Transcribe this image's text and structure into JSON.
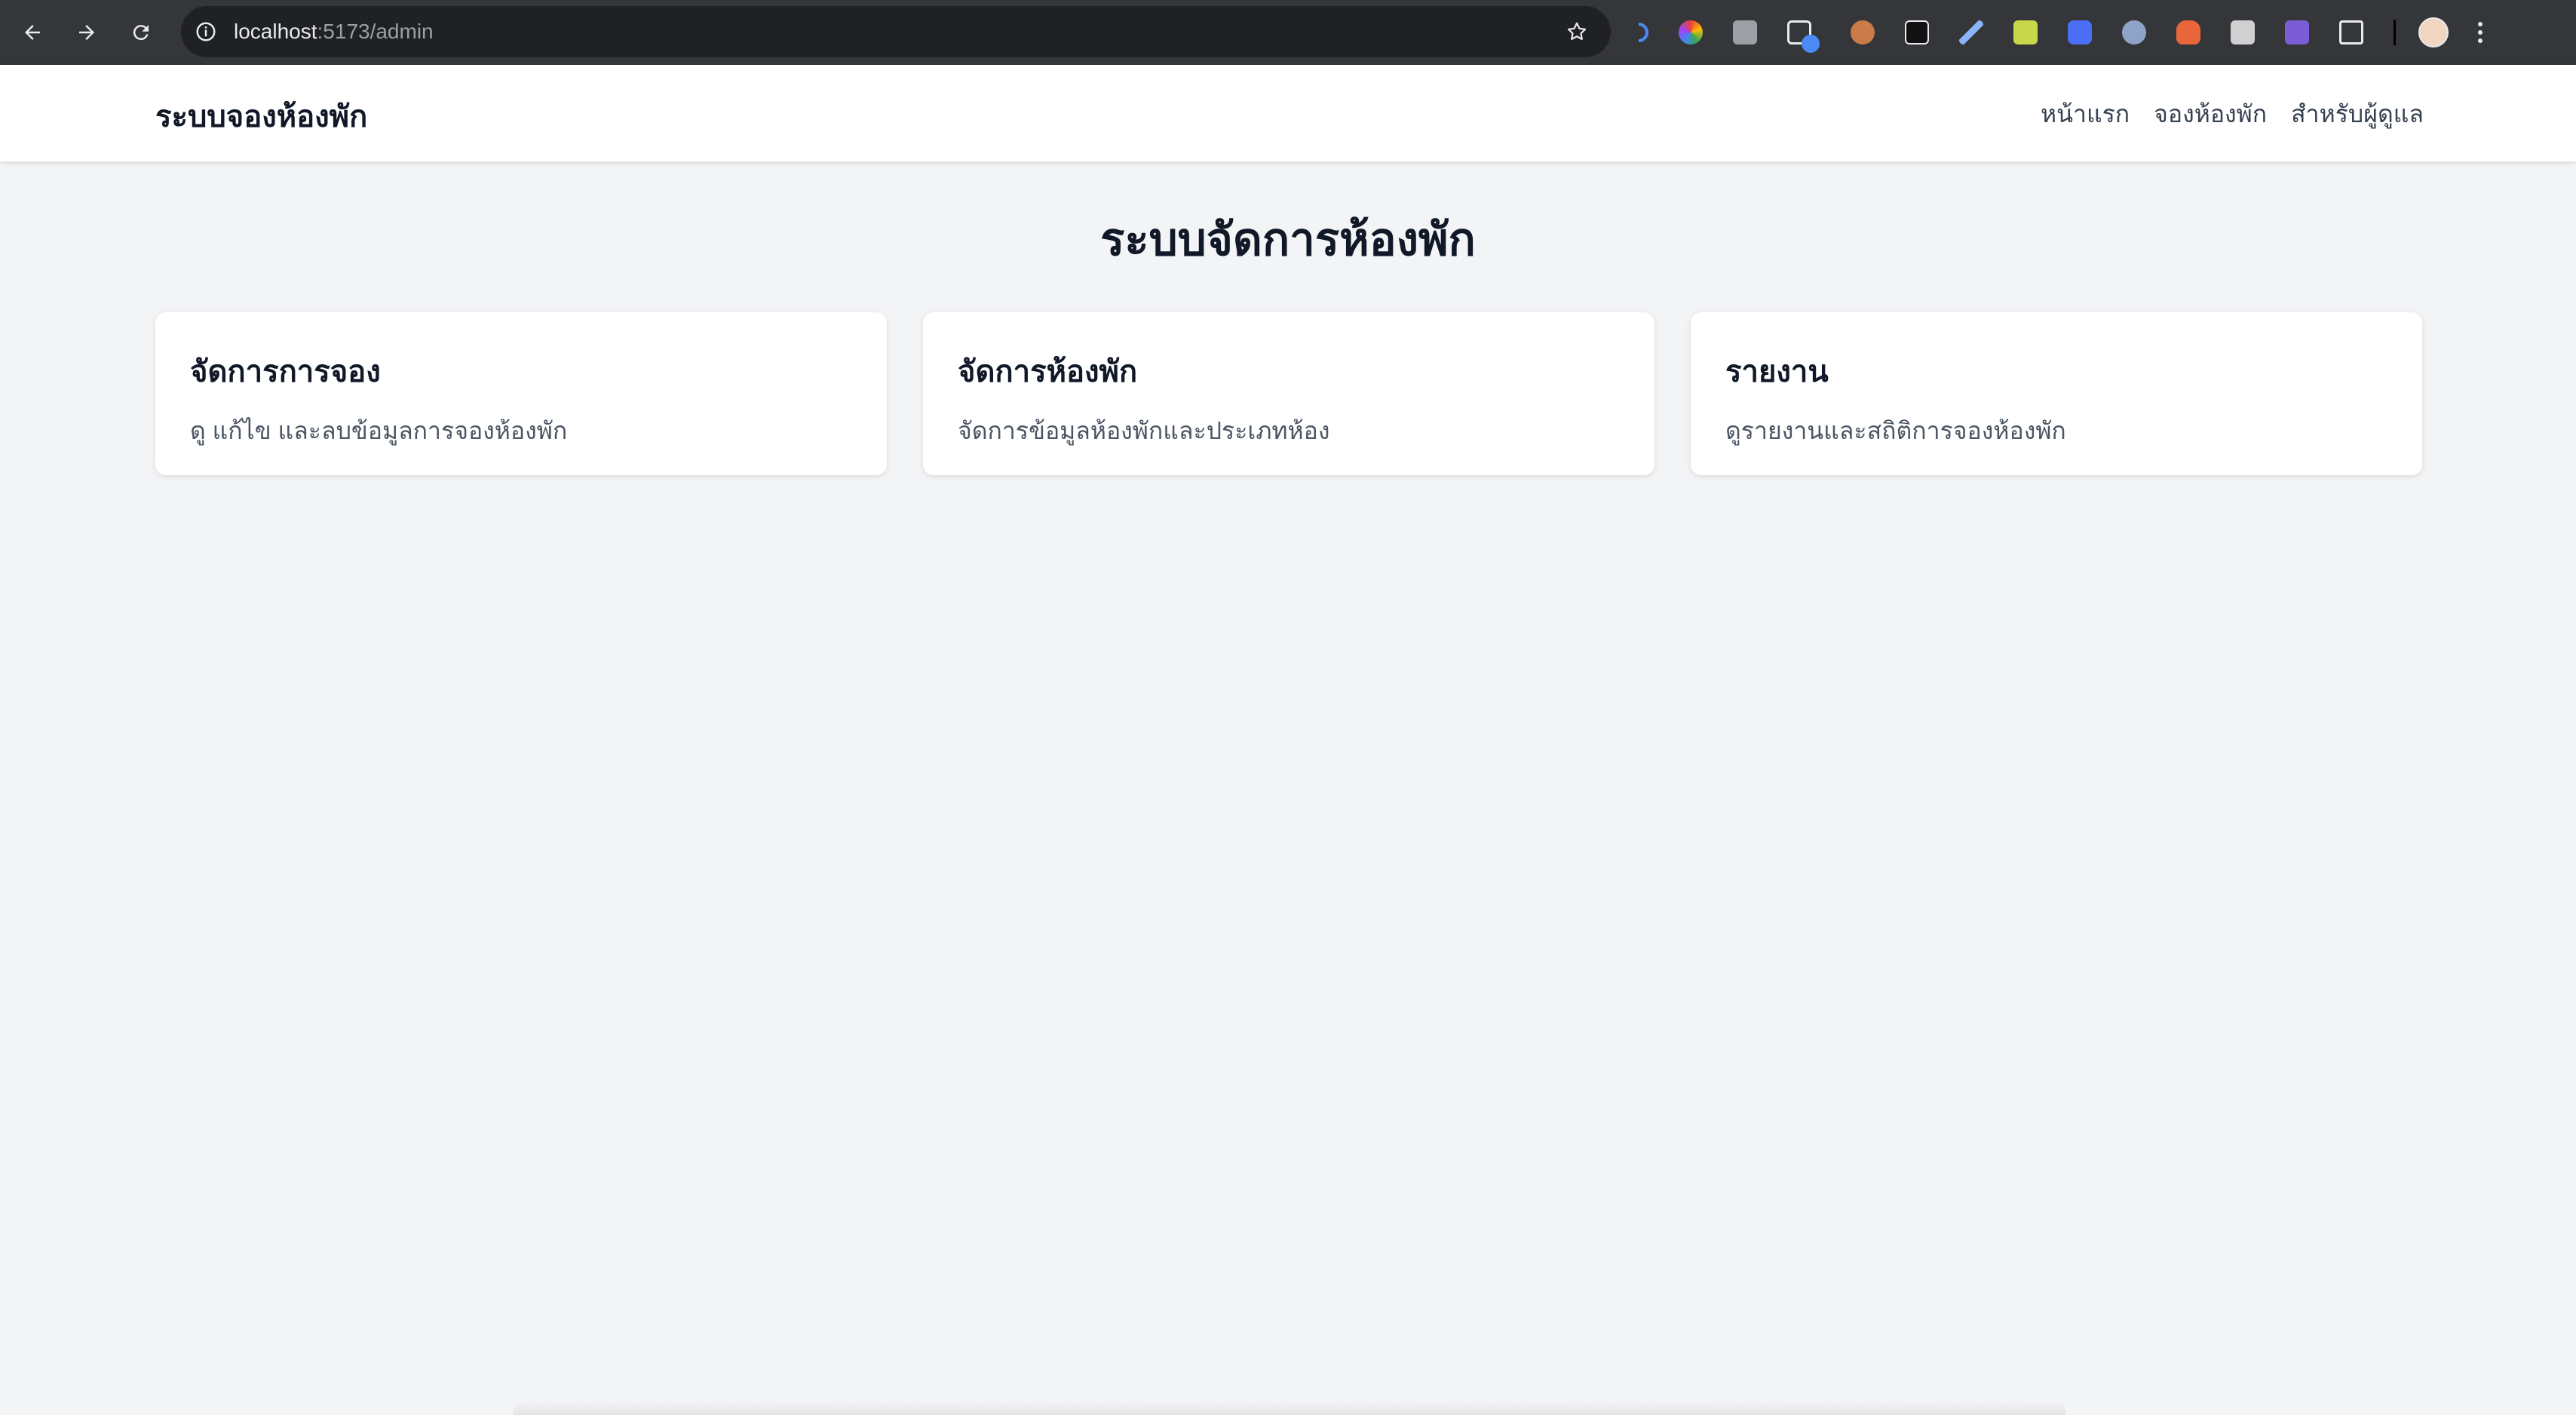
{
  "browser": {
    "url_host": "localhost",
    "url_path": ":5173/admin",
    "extensions": [
      {
        "name": "voice-icon",
        "color": "#4c8bf5"
      },
      {
        "name": "color-wheel-icon",
        "color": "#e84393"
      },
      {
        "name": "camera-icon",
        "color": "#9aa0a6"
      },
      {
        "name": "screen-share-icon",
        "color": "#8ab4f8"
      },
      {
        "name": "cookie-icon",
        "color": "#c97b4a"
      },
      {
        "name": "glasses-icon",
        "color": "#ffffff"
      },
      {
        "name": "pen-icon",
        "color": "#8ab4f8"
      },
      {
        "name": "notes-icon",
        "color": "#c8d64a"
      },
      {
        "name": "doc-icon",
        "color": "#4c6ef5"
      },
      {
        "name": "gear-ext-icon",
        "color": "#8fa3c8"
      },
      {
        "name": "fox-icon",
        "color": "#e8663a"
      },
      {
        "name": "swift-icon",
        "color": "#d0d0d0"
      },
      {
        "name": "v-icon",
        "color": "#7b5cd6"
      },
      {
        "name": "puzzle-icon",
        "color": "#e8eaed"
      }
    ]
  },
  "header": {
    "brand": "ระบบจองห้องพัก",
    "nav": [
      {
        "label": "หน้าแรก"
      },
      {
        "label": "จองห้องพัก"
      },
      {
        "label": "สำหรับผู้ดูแล"
      }
    ]
  },
  "main": {
    "title": "ระบบจัดการห้องพัก",
    "cards": [
      {
        "title": "จัดการการจอง",
        "desc": "ดู แก้ไข และลบข้อมูลการจองห้องพัก"
      },
      {
        "title": "จัดการห้องพัก",
        "desc": "จัดการข้อมูลห้องพักและประเภทห้อง"
      },
      {
        "title": "รายงาน",
        "desc": "ดูรายงานและสถิติการจองห้องพัก"
      }
    ]
  }
}
